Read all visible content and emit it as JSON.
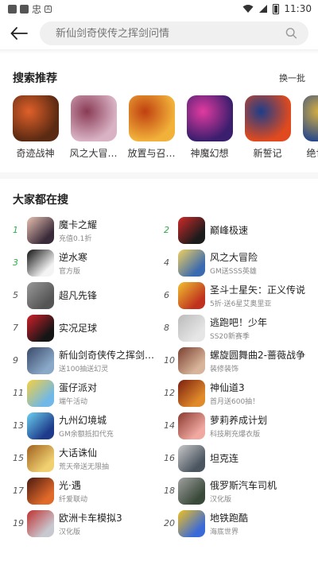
{
  "status_bar": {
    "time": "11:30",
    "left_glyph": "忠"
  },
  "search": {
    "placeholder": "新仙剑奇侠传之挥剑问情"
  },
  "recommend": {
    "title": "搜索推荐",
    "refresh_label": "换一批",
    "items": [
      {
        "name": "奇迹战神",
        "icon": "sword-flame-icon",
        "color": "#5a2a12",
        "accent": "#e0602a"
      },
      {
        "name": "风之大冒…",
        "icon": "anime-girl-icon",
        "color": "#d9b2c4",
        "accent": "#8a3b55"
      },
      {
        "name": "放置与召…",
        "icon": "fox-spirit-icon",
        "color": "#f2b23a",
        "accent": "#c04010"
      },
      {
        "name": "神魔幻想",
        "icon": "hero-armor-icon",
        "color": "#3b1e6e",
        "accent": "#e23aa0"
      },
      {
        "name": "新誓记",
        "icon": "ninja-icon",
        "color": "#e04a1e",
        "accent": "#1d3d8a"
      },
      {
        "name": "绝世战…",
        "icon": "warrior-icon",
        "color": "#2a4a8a",
        "accent": "#d8b040"
      }
    ]
  },
  "hot": {
    "title": "大家都在搜",
    "items": [
      {
        "rank": "1",
        "name": "魔卡之耀",
        "sub": "充值0.1折",
        "icon": "card-girl-icon",
        "color": "#3a2b3a",
        "accent": "#e8c0b0"
      },
      {
        "rank": "2",
        "name": "巅峰极速",
        "sub": "",
        "icon": "race-car-icon",
        "color": "#1b1b1b",
        "accent": "#d02a2a"
      },
      {
        "rank": "3",
        "name": "逆水寒",
        "sub": "官方版",
        "icon": "calligraphy-icon",
        "color": "#f4f4f4",
        "accent": "#111111"
      },
      {
        "rank": "4",
        "name": "风之大冒险",
        "sub": "GM送SSS英雄",
        "icon": "wind-adventure-icon",
        "color": "#3a6ab0",
        "accent": "#f0d060"
      },
      {
        "rank": "5",
        "name": "超凡先锋",
        "sub": "",
        "icon": "soldier-icon",
        "color": "#555555",
        "accent": "#999999"
      },
      {
        "rank": "6",
        "name": "圣斗士星矢：正义传说",
        "sub": "5折·送6星艾奥里亚",
        "icon": "saint-icon",
        "color": "#c0321e",
        "accent": "#f0c030"
      },
      {
        "rank": "7",
        "name": "实况足球",
        "sub": "",
        "icon": "football-icon",
        "color": "#151515",
        "accent": "#d0202a"
      },
      {
        "rank": "8",
        "name": "逃跑吧！少年",
        "sub": "SS20新赛季",
        "icon": "runner-icon",
        "color": "#e6e6e6",
        "accent": "#bbbbbb"
      },
      {
        "rank": "9",
        "name": "新仙剑奇侠传之挥剑问情",
        "sub": "送100抽送幻灵",
        "icon": "sword-heroine-icon",
        "color": "#8aa8c8",
        "accent": "#3a4a6a"
      },
      {
        "rank": "10",
        "name": "螺旋圆舞曲2-蔷薇战争",
        "sub": "装修装饰",
        "icon": "waltz-icon",
        "color": "#d8b49a",
        "accent": "#7a4030"
      },
      {
        "rank": "11",
        "name": "蛋仔派对",
        "sub": "端午活动",
        "icon": "eggy-icon",
        "color": "#6fb8e8",
        "accent": "#f5d040"
      },
      {
        "rank": "12",
        "name": "神仙道3",
        "sub": "首月送600抽！",
        "icon": "immortal-icon",
        "color": "#e08a2a",
        "accent": "#7a1e10"
      },
      {
        "rank": "13",
        "name": "九州幻境城",
        "sub": "GM余额抵扣代充",
        "icon": "fantasy-city-icon",
        "color": "#1e3a8a",
        "accent": "#6ad0f0"
      },
      {
        "rank": "14",
        "name": "萝莉养成计划",
        "sub": "科技刷充爆衣版",
        "icon": "chibi-girl-icon",
        "color": "#f0a8a0",
        "accent": "#8a3a30"
      },
      {
        "rank": "15",
        "name": "大话诛仙",
        "sub": "荒天帝送无限抽",
        "icon": "xianxia-icon",
        "color": "#f0d070",
        "accent": "#a06020"
      },
      {
        "rank": "16",
        "name": "坦克连",
        "sub": "",
        "icon": "tank-icon",
        "color": "#4a5560",
        "accent": "#c8c8c8"
      },
      {
        "rank": "17",
        "name": "光·遇",
        "sub": "纤爱联动",
        "icon": "sky-child-icon",
        "color": "#e06a2a",
        "accent": "#4a1a10"
      },
      {
        "rank": "18",
        "name": "俄罗斯汽车司机",
        "sub": "汉化版",
        "icon": "car-driver-icon",
        "color": "#3a4a3a",
        "accent": "#a0a0a0"
      },
      {
        "rank": "19",
        "name": "欧洲卡车模拟3",
        "sub": "汉化版",
        "icon": "truck-icon",
        "color": "#c8c8d0",
        "accent": "#c03030"
      },
      {
        "rank": "20",
        "name": "地铁跑酷",
        "sub": "海底世界",
        "icon": "subway-surfer-icon",
        "color": "#3a6ad8",
        "accent": "#f0c020"
      }
    ]
  },
  "colors": {
    "rank_top": "#2db046",
    "search_bg": "#f0f0f0",
    "placeholder": "#9a9a9a"
  }
}
